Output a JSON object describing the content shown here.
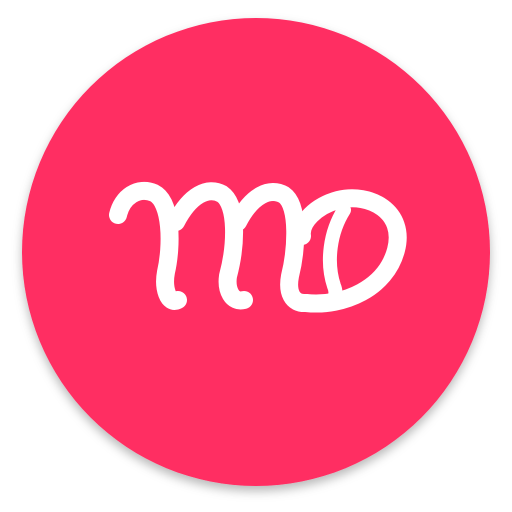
{
  "icon": {
    "name": "md-app-icon",
    "logo_text": "MD",
    "colors": {
      "background": "#ff2d62",
      "logo": "#ffffff",
      "shadow": "#9e1f3f"
    }
  }
}
